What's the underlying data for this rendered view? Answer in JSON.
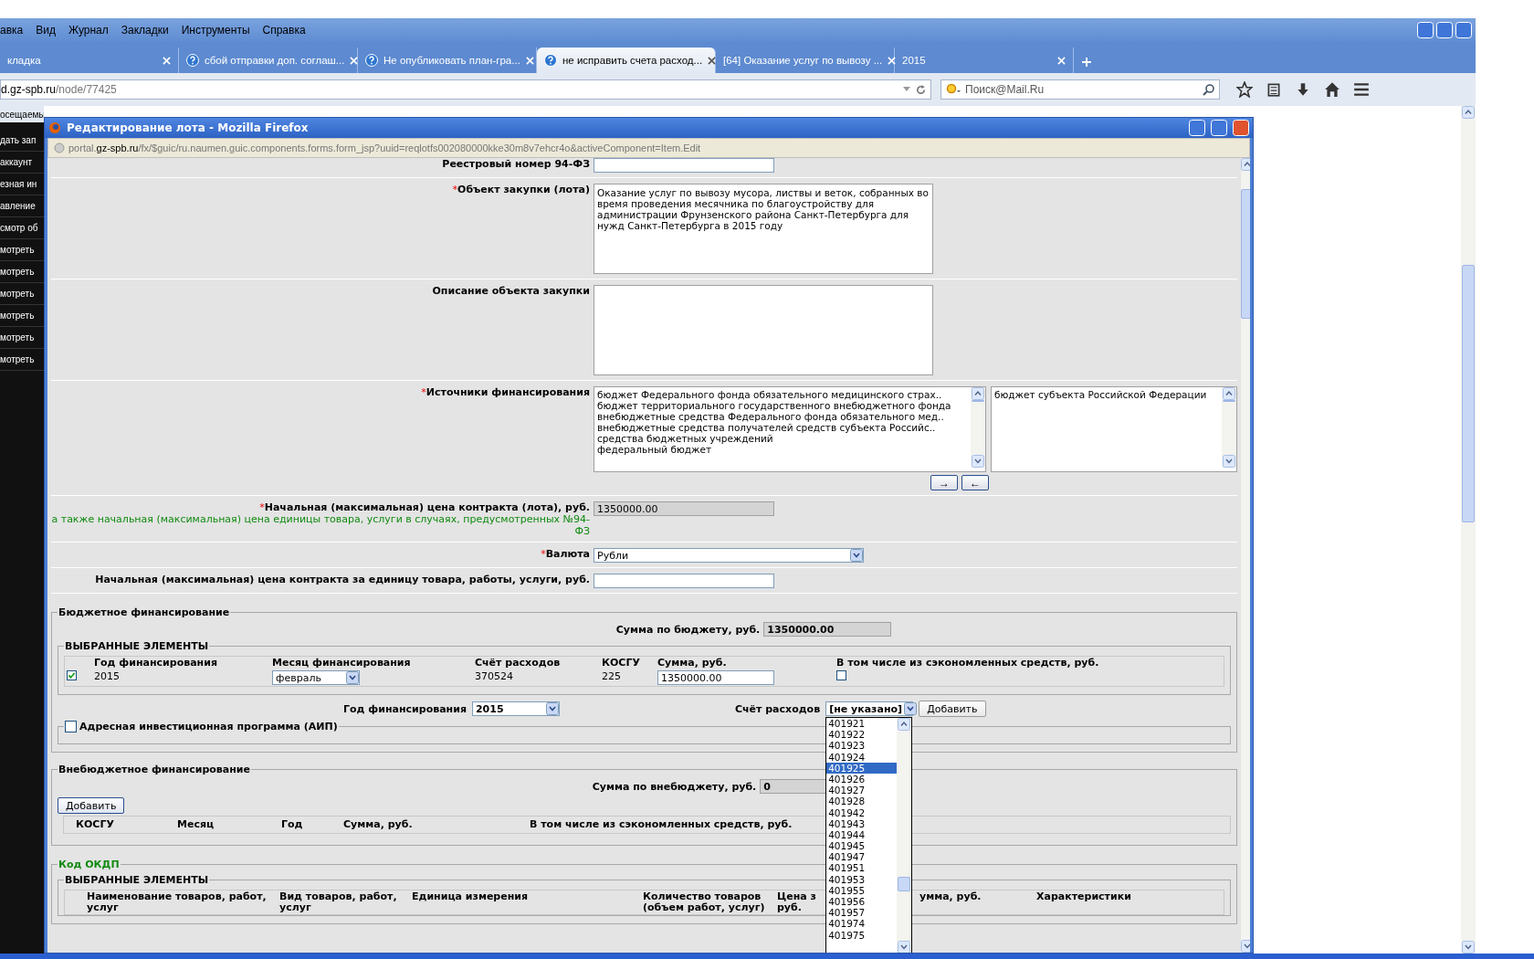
{
  "browser": {
    "menu": [
      "авка",
      "Вид",
      "Журнал",
      "Закладки",
      "Инструменты",
      "Справка"
    ],
    "tabs": [
      {
        "label": "кладка",
        "selected": false,
        "icon": false
      },
      {
        "label": "сбой отправки доп. соглаш...",
        "selected": false,
        "icon": true
      },
      {
        "label": "Не опубликовать план-гра...",
        "selected": false,
        "icon": true
      },
      {
        "label": "не исправить счета расход...",
        "selected": true,
        "icon": true
      },
      {
        "label": "[64] Оказание услуг по вывозу ...",
        "selected": false,
        "icon": false
      },
      {
        "label": "2015",
        "selected": false,
        "icon": false
      }
    ],
    "url_host": "d.gz-spb.ru",
    "url_path": "/node/77425",
    "search_placeholder": "Поиск@Mail.Ru",
    "bookmark": "осещаемы",
    "sidebar_items": [
      "дать зап",
      "аккаунт",
      "езная ин",
      "авление",
      "смотр об",
      "мотреть",
      "мотреть",
      "мотреть",
      "мотреть",
      "мотреть",
      "мотреть"
    ]
  },
  "dialog": {
    "title": "Редактирование лота - Mozilla Firefox",
    "url_prefix": "portal.",
    "url_host": "gz-spb.ru",
    "url_path": "/fx/$guic/ru.naumen.guic.components.forms.form_jsp?uuid=reqlotfs002080000kke30m8v7ehcr4o&activeComponent=Item.Edit",
    "rows": [
      {
        "kind": "input",
        "label": "Реестровый номер 94-ФЗ",
        "disabled": false
      },
      {
        "kind": "textarea",
        "mark": "*",
        "label": "Объект закупки (лота)",
        "value": "Оказание услуг по вывозу мусора, листвы и веток, собранных во время проведения месячника по благоустройству для администрации Фрунзенского района Санкт-Петербурга для нужд Санкт-Петербурга в 2015 году"
      },
      {
        "kind": "textarea",
        "label": "Описание объекта закупки"
      },
      {
        "kind": "dual_list",
        "mark": "*",
        "label": "Источники финансирования",
        "available": [
          "бюджет Федерального фонда обязательного медицинского страх..",
          "бюджет территориального государственного внебюджетного фонда",
          "внебюджетные средства Федерального фонда обязательного мед..",
          "внебюджетные средства получателей средств субъекта Российс..",
          "средства бюджетных учреждений",
          "федеральный бюджет"
        ],
        "chosen": [
          "бюджет субъекта Российской Федерации"
        ],
        "buttons": [
          "→",
          "←"
        ]
      },
      {
        "kind": "input",
        "mark": "*",
        "label": "Начальная (максимальная) цена контракта (лота), руб.",
        "note": "а также начальная (максимальная) цена единицы товара, услуги в случаях, предусмотренных №94-ФЗ",
        "value": "1350000.00",
        "disabled": true
      },
      {
        "kind": "select",
        "mark": "*",
        "label": "Валюта",
        "value": "Рубли"
      },
      {
        "kind": "input",
        "label": "Начальная (максимальная) цена контракта за единицу товара, работы, услуги, руб.",
        "disabled": false
      }
    ],
    "budget": {
      "legend": "Бюджетное финансирование",
      "sum_label": "Сумма по бюджету, руб.",
      "sum_value": "1350000.00",
      "selected_legend": "ВЫБРАННЫЕ ЭЛЕМЕНТЫ",
      "columns": [
        "Год финансирования",
        "Месяц финансирования",
        "Счёт расходов",
        "КОСГУ",
        "Сумма, руб.",
        "В том числе из сэкономленных средств, руб."
      ],
      "rows": [
        {
          "checked": true,
          "year": "2015",
          "month": "февраль",
          "account": "370524",
          "kosgu": "225",
          "sum": "1350000.00",
          "saved_checked": false
        }
      ],
      "year_label": "Год финансирования",
      "year_value": "2015",
      "account_label": "Счёт расходов",
      "account_value": "[не указано]",
      "add_button": "Добавить",
      "account_options": [
        {
          "label": "401921",
          "selected": false
        },
        {
          "label": "401922",
          "selected": false
        },
        {
          "label": "401923",
          "selected": false
        },
        {
          "label": "401924",
          "selected": false
        },
        {
          "label": "401925",
          "selected": true
        },
        {
          "label": "401926",
          "selected": false
        },
        {
          "label": "401927",
          "selected": false
        },
        {
          "label": "401928",
          "selected": false
        },
        {
          "label": "401942",
          "selected": false
        },
        {
          "label": "401943",
          "selected": false
        },
        {
          "label": "401944",
          "selected": false
        },
        {
          "label": "401945",
          "selected": false
        },
        {
          "label": "401947",
          "selected": false
        },
        {
          "label": "401951",
          "selected": false
        },
        {
          "label": "401953",
          "selected": false
        },
        {
          "label": "401955",
          "selected": false
        },
        {
          "label": "401956",
          "selected": false
        },
        {
          "label": "401957",
          "selected": false
        },
        {
          "label": "401974",
          "selected": false
        },
        {
          "label": "401975",
          "selected": false
        }
      ],
      "aip": {
        "label": "Адресная инвестиционная программа (АИП)",
        "checked": false
      }
    },
    "offbudget": {
      "legend": "Внебюджетное финансирование",
      "sum_label": "Сумма по внебюджету, руб.",
      "sum_value": "0",
      "add_button": "Добавить",
      "columns": [
        "КОСГУ",
        "Месяц",
        "Год",
        "Сумма, руб.",
        "В том числе из сэкономленных средств, руб."
      ]
    },
    "okdp": {
      "legend": "Код ОКДП",
      "selected_legend": "ВЫБРАННЫЕ ЭЛЕМЕНТЫ",
      "columns": [
        "Наименование товаров, работ,\nуслуг",
        "Вид товаров, работ,\nуслуг",
        "Единица измерения",
        "Количество товаров\n(объем работ, услуг)",
        "Цена з\nруб.",
        "умма, руб.",
        "Характеристики"
      ]
    }
  }
}
